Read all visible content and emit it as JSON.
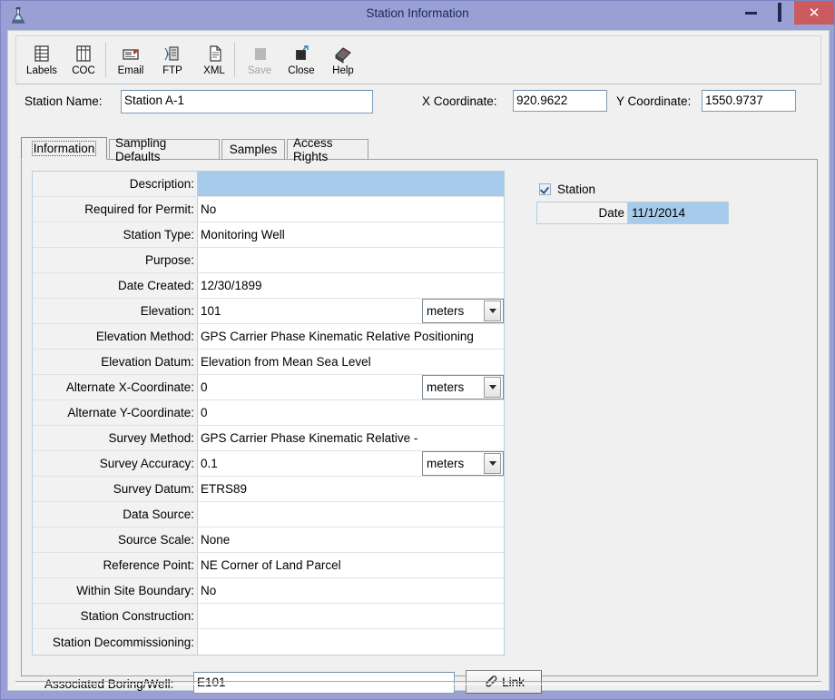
{
  "window": {
    "title": "Station Information",
    "icon": "flask-icon",
    "controls": {
      "minimize": "minimize-icon",
      "maximize": "maximize-icon",
      "close": "✕"
    },
    "close_color": "#cc5b5f",
    "titlebar_color": "#9aa0d4"
  },
  "toolbar": {
    "items": [
      {
        "label": "Labels",
        "icon": "labels-grid-icon",
        "disabled": false
      },
      {
        "label": "COC",
        "icon": "coc-table-icon",
        "disabled": false
      },
      {
        "label": "Email",
        "icon": "email-icon",
        "disabled": false
      },
      {
        "label": "FTP",
        "icon": "ftp-server-icon",
        "disabled": false
      },
      {
        "label": "XML",
        "icon": "xml-document-icon",
        "disabled": false
      },
      {
        "label": "Save",
        "icon": "save-icon",
        "disabled": true
      },
      {
        "label": "Close",
        "icon": "close-folder-icon",
        "disabled": false
      },
      {
        "label": "Help",
        "icon": "help-book-icon",
        "disabled": false
      }
    ]
  },
  "header": {
    "station_name_label": "Station Name:",
    "station_name_value": "Station A-1",
    "x_coordinate_label": "X Coordinate:",
    "x_coordinate_value": "920.9622",
    "y_coordinate_label": "Y Coordinate:",
    "y_coordinate_value": "1550.9737"
  },
  "tabs": [
    {
      "label": "Information",
      "active": true
    },
    {
      "label": "Sampling Defaults",
      "active": false
    },
    {
      "label": "Samples",
      "active": false
    },
    {
      "label": "Access Rights",
      "active": false
    }
  ],
  "grid": {
    "selected_row_color": "#a7cbea",
    "rows": [
      {
        "key": "Description:",
        "value": "",
        "selected": true,
        "unit": null
      },
      {
        "key": "Required for Permit:",
        "value": "No",
        "selected": false,
        "unit": null
      },
      {
        "key": "Station Type:",
        "value": "Monitoring Well",
        "selected": false,
        "unit": null
      },
      {
        "key": "Purpose:",
        "value": "",
        "selected": false,
        "unit": null
      },
      {
        "key": "Date Created:",
        "value": "12/30/1899",
        "selected": false,
        "unit": null
      },
      {
        "key": "Elevation:",
        "value": "101",
        "selected": false,
        "unit": "meters"
      },
      {
        "key": "Elevation Method:",
        "value": "GPS Carrier Phase Kinematic Relative Positioning",
        "selected": false,
        "unit": null
      },
      {
        "key": "Elevation Datum:",
        "value": "Elevation from Mean Sea Level",
        "selected": false,
        "unit": null
      },
      {
        "key": "Alternate X-Coordinate:",
        "value": "0",
        "selected": false,
        "unit": "meters"
      },
      {
        "key": "Alternate Y-Coordinate:",
        "value": "0",
        "selected": false,
        "unit": null
      },
      {
        "key": "Survey Method:",
        "value": "GPS Carrier Phase Kinematic Relative -",
        "selected": false,
        "unit": null
      },
      {
        "key": "Survey Accuracy:",
        "value": "0.1",
        "selected": false,
        "unit": "meters"
      },
      {
        "key": "Survey Datum:",
        "value": "ETRS89",
        "selected": false,
        "unit": null
      },
      {
        "key": "Data Source:",
        "value": "",
        "selected": false,
        "unit": null
      },
      {
        "key": "Source Scale:",
        "value": "None",
        "selected": false,
        "unit": null
      },
      {
        "key": "Reference Point:",
        "value": "NE Corner of Land Parcel",
        "selected": false,
        "unit": null
      },
      {
        "key": "Within Site Boundary:",
        "value": "No",
        "selected": false,
        "unit": null
      },
      {
        "key": "Station Construction:",
        "value": "",
        "selected": false,
        "unit": null
      },
      {
        "key": "Station Decommissioning:",
        "value": "",
        "selected": false,
        "unit": null
      }
    ]
  },
  "right_panel": {
    "station_checkbox_label": "Station",
    "station_checkbox_checked": true,
    "date_label": "Date",
    "date_value": "11/1/2014"
  },
  "footer": {
    "assoc_label": "Associated Boring/Well:",
    "assoc_value": "E101",
    "link_label": "Link",
    "link_icon": "paperclip-icon"
  }
}
